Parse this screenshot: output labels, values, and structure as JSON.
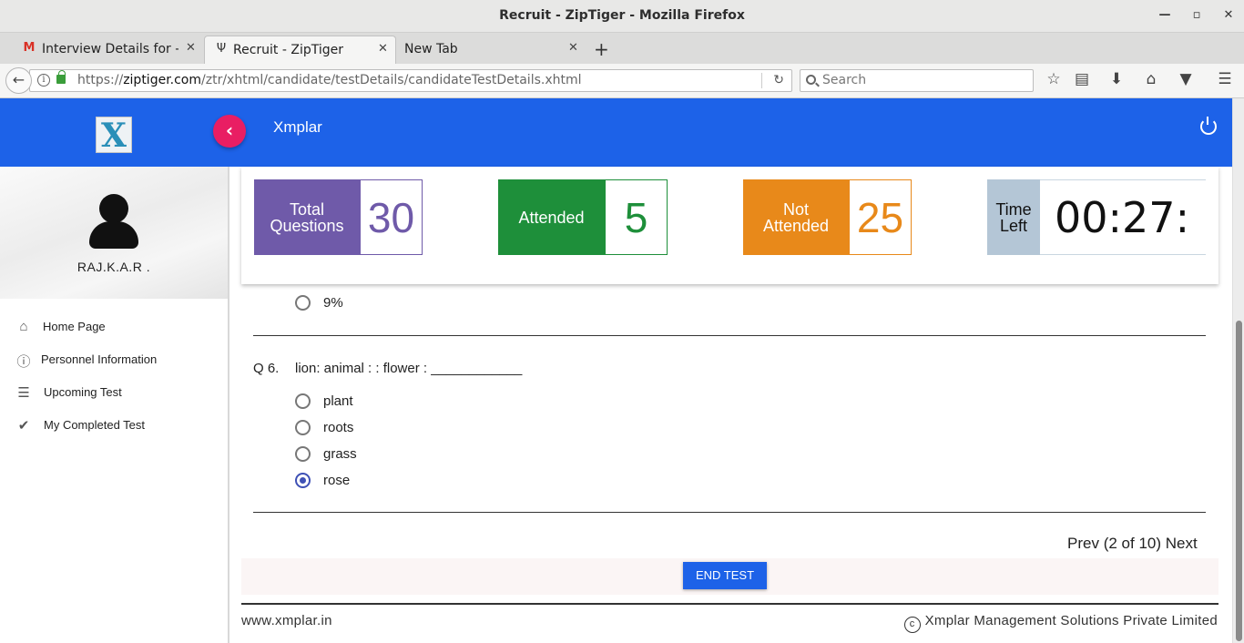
{
  "window": {
    "title": "Recruit - ZipTiger - Mozilla Firefox",
    "controls": [
      "minimize",
      "maximize",
      "close"
    ]
  },
  "tabs": [
    {
      "label": "Interview Details for -...",
      "icon": "gmail-icon",
      "active": false
    },
    {
      "label": "Recruit - ZipTiger",
      "icon": "ziptiger-icon",
      "active": true
    },
    {
      "label": "New Tab",
      "icon": "",
      "active": false
    }
  ],
  "navbar": {
    "url_prefix": "https://",
    "url_domain": "ziptiger.com",
    "url_path": "/ztr/xhtml/candidate/testDetails/candidateTestDetails.xhtml",
    "search_placeholder": "Search"
  },
  "app": {
    "brand": "Xmplar",
    "logo_text": "X",
    "accent_color": "#1d62e8",
    "collapse_color": "#e91e63"
  },
  "sidebar": {
    "username": "RAJ.K.A.R .",
    "items": [
      {
        "label": "Home Page",
        "icon": "home-icon"
      },
      {
        "label": "Personnel Information",
        "icon": "info-icon"
      },
      {
        "label": "Upcoming Test",
        "icon": "list-icon"
      },
      {
        "label": "My Completed Test",
        "icon": "check-icon"
      }
    ]
  },
  "stats": {
    "total": {
      "label_line1": "Total",
      "label_line2": "Questions",
      "value": "30",
      "color": "#6f5aa9"
    },
    "attended": {
      "label": "Attended",
      "value": "5",
      "color": "#1e8f3a"
    },
    "not_attended": {
      "label_line1": "Not",
      "label_line2": "Attended",
      "value": "25",
      "color": "#e8891a"
    },
    "time_left": {
      "label_line1": "Time",
      "label_line2": "Left",
      "value": "00:27:"
    }
  },
  "prev_question": {
    "last_option": "9%"
  },
  "question": {
    "number": "Q 6.",
    "text": "lion: animal : : flower : ____________",
    "options": [
      {
        "label": "plant",
        "selected": false
      },
      {
        "label": "roots",
        "selected": false
      },
      {
        "label": "grass",
        "selected": false
      },
      {
        "label": "rose",
        "selected": true
      }
    ]
  },
  "pager": {
    "prev": "Prev",
    "status": "(2 of 10)",
    "next": "Next"
  },
  "end_test_label": "END TEST",
  "footer": {
    "left": "www.xmplar.in",
    "right": "Xmplar Management Solutions Private Limited",
    "copyright_symbol": "c"
  }
}
